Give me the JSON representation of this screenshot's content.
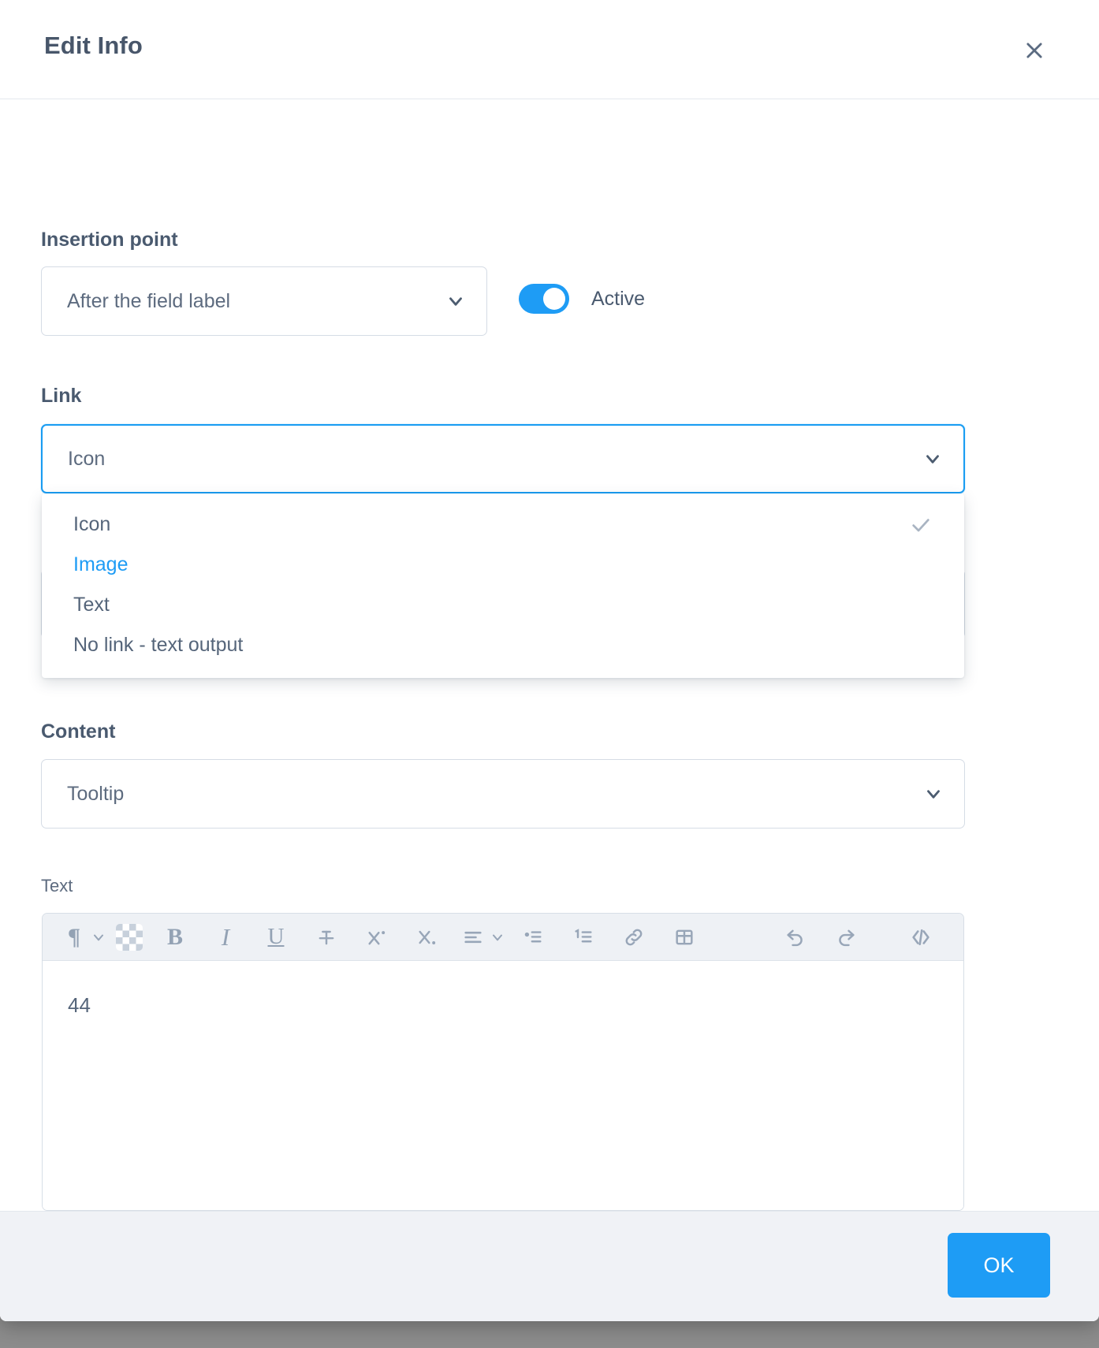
{
  "dialog": {
    "title": "Edit Info",
    "close_icon": "close-icon"
  },
  "insertion_point": {
    "label": "Insertion point",
    "value": "After the field label",
    "chevron_icon": "chevron-down-icon"
  },
  "active_toggle": {
    "label": "Active",
    "state": "on",
    "accent": "#1e9cf5"
  },
  "link": {
    "label": "Link",
    "value": "Icon",
    "chevron_icon": "chevron-down-icon",
    "options": [
      {
        "label": "Icon",
        "selected": true,
        "hovered": false,
        "check_icon": "check-icon"
      },
      {
        "label": "Image",
        "selected": false,
        "hovered": true
      },
      {
        "label": "Text",
        "selected": false,
        "hovered": false
      },
      {
        "label": "No link - text output",
        "selected": false,
        "hovered": false
      }
    ]
  },
  "content": {
    "label": "Content",
    "value": "Tooltip",
    "chevron_icon": "chevron-down-icon"
  },
  "text_editor": {
    "label": "Text",
    "value": "44",
    "toolbar": [
      {
        "name": "paragraph-format-button",
        "icon": "paragraph-icon",
        "glyph": "¶",
        "has_chevron": true
      },
      {
        "name": "text-color-button",
        "icon": "color-swatch-icon"
      },
      {
        "name": "bold-button",
        "icon": "bold-icon",
        "glyph": "B"
      },
      {
        "name": "italic-button",
        "icon": "italic-icon",
        "glyph": "I"
      },
      {
        "name": "underline-button",
        "icon": "underline-icon",
        "glyph": "U"
      },
      {
        "name": "strikethrough-button",
        "icon": "strikethrough-icon"
      },
      {
        "name": "superscript-button",
        "icon": "superscript-icon"
      },
      {
        "name": "subscript-button",
        "icon": "subscript-icon"
      },
      {
        "name": "align-button",
        "icon": "align-left-icon",
        "has_chevron": true
      },
      {
        "name": "bullet-list-button",
        "icon": "bullet-list-icon"
      },
      {
        "name": "numbered-list-button",
        "icon": "numbered-list-icon"
      },
      {
        "name": "insert-link-button",
        "icon": "link-icon"
      },
      {
        "name": "insert-table-button",
        "icon": "table-icon"
      },
      {
        "name": "undo-button",
        "icon": "undo-icon"
      },
      {
        "name": "redo-button",
        "icon": "redo-icon"
      },
      {
        "name": "source-code-button",
        "icon": "code-icon"
      }
    ]
  },
  "footer": {
    "ok_label": "OK",
    "ok_color": "#1e9cf5"
  }
}
